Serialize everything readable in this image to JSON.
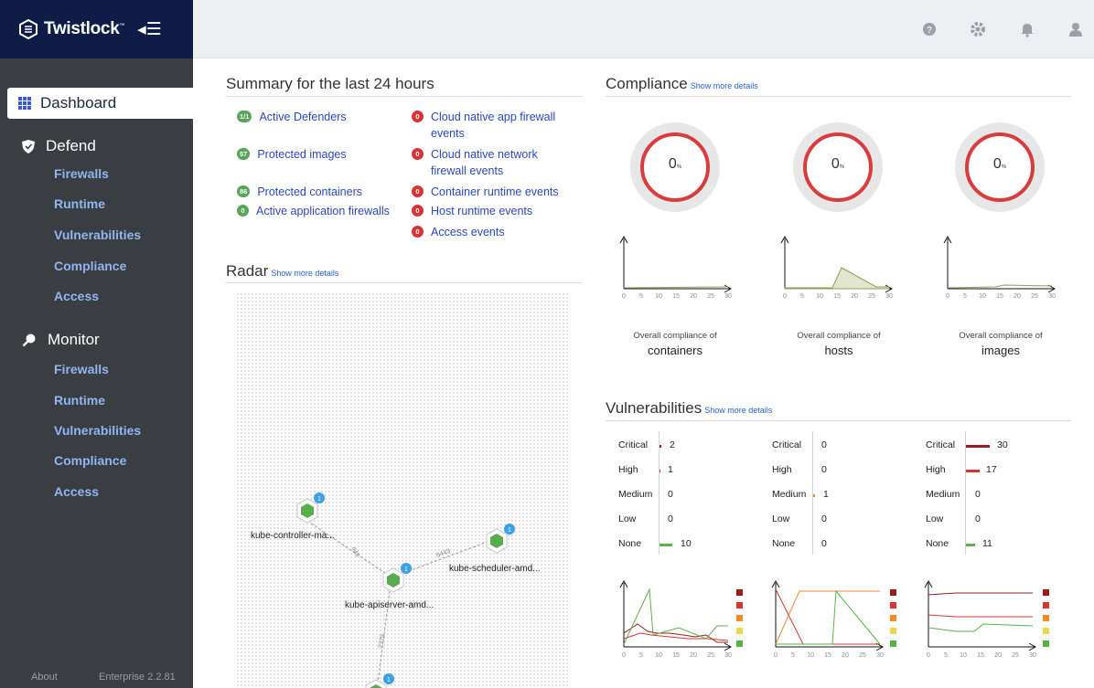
{
  "brand": {
    "name": "Twistlock",
    "mark": "™"
  },
  "sidebar": {
    "dashboard": "Dashboard",
    "defend": {
      "label": "Defend",
      "items": [
        "Firewalls",
        "Runtime",
        "Vulnerabilities",
        "Compliance",
        "Access"
      ]
    },
    "monitor": {
      "label": "Monitor",
      "items": [
        "Firewalls",
        "Runtime",
        "Vulnerabilities",
        "Compliance",
        "Access"
      ]
    },
    "about": "About",
    "version": "Enterprise 2.2.81"
  },
  "summary": {
    "title": "Summary for the last 24 hours",
    "left": [
      {
        "badge": "1/1",
        "label": "Active Defenders"
      },
      {
        "badge": "57",
        "label": "Protected images"
      },
      {
        "badge": "86",
        "label": "Protected containers"
      },
      {
        "badge": "0",
        "label": "Active application firewalls"
      }
    ],
    "right": [
      {
        "badge": "0",
        "label_1": "Cloud native app firewall",
        "label_2": "events"
      },
      {
        "badge": "0",
        "label_1": "Cloud native network",
        "label_2": "firewall events"
      },
      {
        "badge": "0",
        "label_1": "Container runtime events"
      },
      {
        "badge": "0",
        "label_1": "Host runtime events"
      },
      {
        "badge": "0",
        "label_1": "Access events"
      }
    ]
  },
  "radar": {
    "title": "Radar",
    "more": "Show more details",
    "nodes": [
      {
        "label": "kube-controller-ma...",
        "count": "1"
      },
      {
        "label": "kube-scheduler-amd...",
        "count": "1"
      },
      {
        "label": "kube-apiserver-amd...",
        "count": "1"
      },
      {
        "label": "",
        "count": "1"
      }
    ],
    "ports": [
      "443",
      "6443",
      "2379"
    ]
  },
  "compliance": {
    "title": "Compliance",
    "more": "Show more details",
    "caption": "Overall compliance of",
    "cards": [
      {
        "value": "0",
        "unit": "%",
        "type": "containers"
      },
      {
        "value": "0",
        "unit": "%",
        "type": "hosts"
      },
      {
        "value": "0",
        "unit": "%",
        "type": "images"
      }
    ],
    "x_ticks": [
      "0",
      "5",
      "10",
      "15",
      "20",
      "25",
      "30"
    ]
  },
  "vulnerabilities": {
    "title": "Vulnerabilities",
    "more": "Show more details",
    "levels": [
      "Critical",
      "High",
      "Medium",
      "Low",
      "None"
    ],
    "groups": [
      {
        "values": [
          "2",
          "1",
          "0",
          "0",
          "10"
        ]
      },
      {
        "values": [
          "0",
          "0",
          "1",
          "0",
          "0"
        ]
      },
      {
        "values": [
          "30",
          "17",
          "0",
          "0",
          "11"
        ]
      }
    ],
    "colors": {
      "critical": "#9b1c1c",
      "high": "#d93434",
      "medium": "#f08a2c",
      "low": "#e8d84a",
      "none": "#58b347"
    }
  }
}
